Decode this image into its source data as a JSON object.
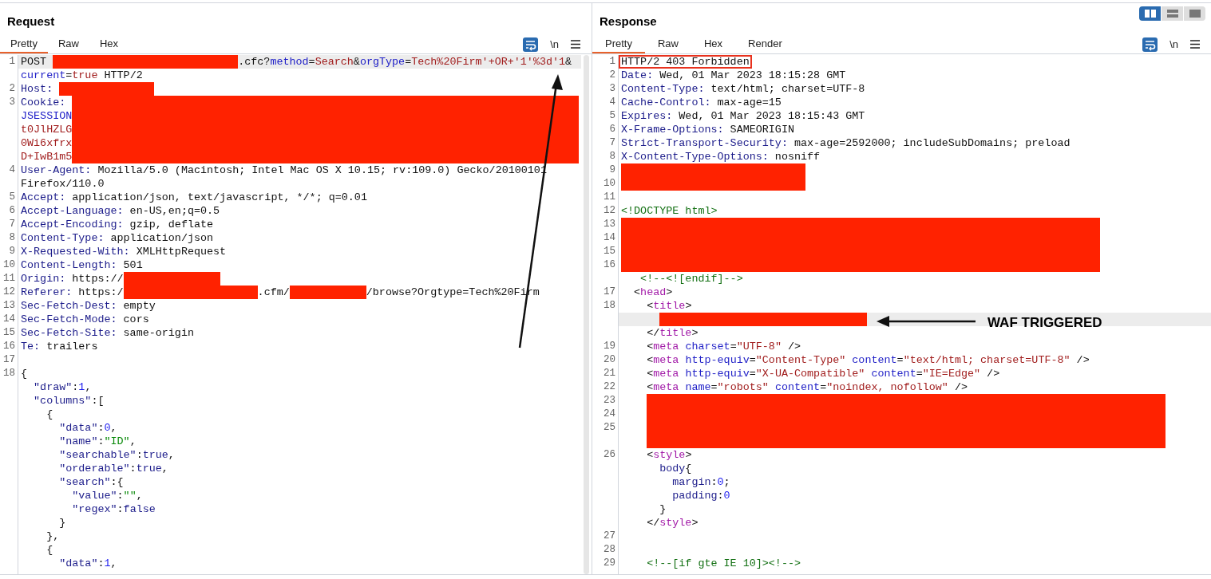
{
  "request": {
    "title": "Request",
    "tabs": [
      {
        "label": "Pretty",
        "selected": true
      },
      {
        "label": "Raw",
        "selected": false
      },
      {
        "label": "Hex",
        "selected": false
      }
    ],
    "newline_toggle": "\\n",
    "rows": [
      {
        "num": "1",
        "highlighted": true,
        "segs": [
          {
            "kind": "text",
            "text": "POST "
          },
          {
            "kind": "redacted"
          },
          {
            "kind": "text",
            "text": ".cfc?"
          },
          {
            "kind": "param",
            "text": "method"
          },
          {
            "kind": "text",
            "text": "="
          },
          {
            "kind": "value",
            "text": "Search"
          },
          {
            "kind": "text",
            "text": "&"
          },
          {
            "kind": "param",
            "text": "orgType"
          },
          {
            "kind": "text",
            "text": "="
          },
          {
            "kind": "value",
            "text": "Tech%20Firm'+OR+'1'%3d'1"
          },
          {
            "kind": "text",
            "text": "&"
          }
        ]
      },
      {
        "segs": [
          {
            "kind": "param",
            "text": "current"
          },
          {
            "kind": "text",
            "text": "="
          },
          {
            "kind": "value",
            "text": "true"
          },
          {
            "kind": "text",
            "text": " HTTP/2"
          }
        ]
      },
      {
        "num": "2",
        "segs": [
          {
            "kind": "key",
            "text": "Host: "
          },
          {
            "kind": "redacted"
          }
        ]
      },
      {
        "num": "3",
        "segs": [
          {
            "kind": "key",
            "text": "Cookie: "
          },
          {
            "kind": "redacted"
          }
        ]
      },
      {
        "segs": [
          {
            "kind": "param",
            "text": "JSESSION"
          },
          {
            "kind": "redacted"
          }
        ]
      },
      {
        "segs": [
          {
            "kind": "value",
            "text": "t0JlHZLG"
          },
          {
            "kind": "redacted"
          }
        ]
      },
      {
        "segs": [
          {
            "kind": "value",
            "text": "0Wi6xfrx"
          },
          {
            "kind": "redacted"
          }
        ]
      },
      {
        "segs": [
          {
            "kind": "value",
            "text": "D+IwB1m5"
          },
          {
            "kind": "redacted"
          }
        ]
      },
      {
        "num": "4",
        "segs": [
          {
            "kind": "key",
            "text": "User-Agent:"
          },
          {
            "kind": "text",
            "text": " Mozilla/5.0 (Macintosh; Intel Mac OS X 10.15; rv:109.0) Gecko/20100101"
          }
        ]
      },
      {
        "segs": [
          {
            "kind": "text",
            "text": "Firefox/110.0"
          }
        ]
      },
      {
        "num": "5",
        "segs": [
          {
            "kind": "key",
            "text": "Accept:"
          },
          {
            "kind": "text",
            "text": " application/json, text/javascript, */*; q=0.01"
          }
        ]
      },
      {
        "num": "6",
        "segs": [
          {
            "kind": "key",
            "text": "Accept-Language:"
          },
          {
            "kind": "text",
            "text": " en-US,en;q=0.5"
          }
        ]
      },
      {
        "num": "7",
        "segs": [
          {
            "kind": "key",
            "text": "Accept-Encoding:"
          },
          {
            "kind": "text",
            "text": " gzip, deflate"
          }
        ]
      },
      {
        "num": "8",
        "segs": [
          {
            "kind": "key",
            "text": "Content-Type:"
          },
          {
            "kind": "text",
            "text": " application/json"
          }
        ]
      },
      {
        "num": "9",
        "segs": [
          {
            "kind": "key",
            "text": "X-Requested-With:"
          },
          {
            "kind": "text",
            "text": " XMLHttpRequest"
          }
        ]
      },
      {
        "num": "10",
        "segs": [
          {
            "kind": "key",
            "text": "Content-Length:"
          },
          {
            "kind": "text",
            "text": " 501"
          }
        ]
      },
      {
        "num": "11",
        "segs": [
          {
            "kind": "key",
            "text": "Origin:"
          },
          {
            "kind": "text",
            "text": " https://"
          },
          {
            "kind": "redacted"
          }
        ]
      },
      {
        "num": "12",
        "segs": [
          {
            "kind": "key",
            "text": "Referer:"
          },
          {
            "kind": "text",
            "text": " https:/"
          },
          {
            "kind": "redacted"
          },
          {
            "kind": "text",
            "text": ".cfm/"
          },
          {
            "kind": "redacted"
          },
          {
            "kind": "text",
            "text": "/browse?Orgtype=Tech%20Firm"
          }
        ]
      },
      {
        "num": "13",
        "segs": [
          {
            "kind": "key",
            "text": "Sec-Fetch-Dest:"
          },
          {
            "kind": "text",
            "text": " empty"
          }
        ]
      },
      {
        "num": "14",
        "segs": [
          {
            "kind": "key",
            "text": "Sec-Fetch-Mode:"
          },
          {
            "kind": "text",
            "text": " cors"
          }
        ]
      },
      {
        "num": "15",
        "segs": [
          {
            "kind": "key",
            "text": "Sec-Fetch-Site:"
          },
          {
            "kind": "text",
            "text": " same-origin"
          }
        ]
      },
      {
        "num": "16",
        "segs": [
          {
            "kind": "key",
            "text": "Te:"
          },
          {
            "kind": "text",
            "text": " trailers"
          }
        ]
      },
      {
        "num": "17",
        "segs": []
      },
      {
        "num": "18",
        "segs": [
          {
            "kind": "text",
            "text": "{"
          }
        ]
      },
      {
        "segs": [
          {
            "kind": "key",
            "text": "  \"draw\""
          },
          {
            "kind": "text",
            "text": ":"
          },
          {
            "kind": "number",
            "text": "1"
          },
          {
            "kind": "text",
            "text": ","
          }
        ]
      },
      {
        "segs": [
          {
            "kind": "key",
            "text": "  \"columns\""
          },
          {
            "kind": "text",
            "text": ":["
          }
        ]
      },
      {
        "segs": [
          {
            "kind": "text",
            "text": "    {"
          }
        ]
      },
      {
        "segs": [
          {
            "kind": "key",
            "text": "      \"data\""
          },
          {
            "kind": "text",
            "text": ":"
          },
          {
            "kind": "number",
            "text": "0"
          },
          {
            "kind": "text",
            "text": ","
          }
        ]
      },
      {
        "segs": [
          {
            "kind": "key",
            "text": "      \"name\""
          },
          {
            "kind": "text",
            "text": ":"
          },
          {
            "kind": "string",
            "text": "\"ID\""
          },
          {
            "kind": "text",
            "text": ","
          }
        ]
      },
      {
        "segs": [
          {
            "kind": "key",
            "text": "      \"searchable\""
          },
          {
            "kind": "text",
            "text": ":"
          },
          {
            "kind": "key",
            "text": "true"
          },
          {
            "kind": "text",
            "text": ","
          }
        ]
      },
      {
        "segs": [
          {
            "kind": "key",
            "text": "      \"orderable\""
          },
          {
            "kind": "text",
            "text": ":"
          },
          {
            "kind": "key",
            "text": "true"
          },
          {
            "kind": "text",
            "text": ","
          }
        ]
      },
      {
        "segs": [
          {
            "kind": "key",
            "text": "      \"search\""
          },
          {
            "kind": "text",
            "text": ":{"
          }
        ]
      },
      {
        "segs": [
          {
            "kind": "key",
            "text": "        \"value\""
          },
          {
            "kind": "text",
            "text": ":"
          },
          {
            "kind": "string",
            "text": "\"\""
          },
          {
            "kind": "text",
            "text": ","
          }
        ]
      },
      {
        "segs": [
          {
            "kind": "key",
            "text": "        \"regex\""
          },
          {
            "kind": "text",
            "text": ":"
          },
          {
            "kind": "key",
            "text": "false"
          }
        ]
      },
      {
        "segs": [
          {
            "kind": "text",
            "text": "      }"
          }
        ]
      },
      {
        "segs": [
          {
            "kind": "text",
            "text": "    },"
          }
        ]
      },
      {
        "segs": [
          {
            "kind": "text",
            "text": "    {"
          }
        ]
      },
      {
        "segs": [
          {
            "kind": "key",
            "text": "      \"data\""
          },
          {
            "kind": "text",
            "text": ":"
          },
          {
            "kind": "number",
            "text": "1"
          },
          {
            "kind": "text",
            "text": ","
          }
        ]
      }
    ]
  },
  "response": {
    "title": "Response",
    "layout_buttons": [
      {
        "kind": "columns",
        "selected": true
      },
      {
        "kind": "rows",
        "selected": false
      },
      {
        "kind": "single",
        "selected": false
      }
    ],
    "tabs": [
      {
        "label": "Pretty",
        "selected": true
      },
      {
        "label": "Raw",
        "selected": false
      },
      {
        "label": "Hex",
        "selected": false
      },
      {
        "label": "Render",
        "selected": false
      }
    ],
    "newline_toggle": "\\n",
    "annotation": {
      "label": "WAF TRIGGERED"
    },
    "rows": [
      {
        "num": "1",
        "segs": [
          {
            "kind": "text",
            "text": "HTTP/2 403 Forbidden",
            "boxed": true
          }
        ]
      },
      {
        "num": "2",
        "segs": [
          {
            "kind": "key",
            "text": "Date:"
          },
          {
            "kind": "text",
            "text": " Wed, 01 Mar 2023 18:15:28 GMT"
          }
        ]
      },
      {
        "num": "3",
        "segs": [
          {
            "kind": "key",
            "text": "Content-Type:"
          },
          {
            "kind": "text",
            "text": " text/html; charset=UTF-8"
          }
        ]
      },
      {
        "num": "4",
        "segs": [
          {
            "kind": "key",
            "text": "Cache-Control:"
          },
          {
            "kind": "text",
            "text": " max-age=15"
          }
        ]
      },
      {
        "num": "5",
        "segs": [
          {
            "kind": "key",
            "text": "Expires:"
          },
          {
            "kind": "text",
            "text": " Wed, 01 Mar 2023 18:15:43 GMT"
          }
        ]
      },
      {
        "num": "6",
        "segs": [
          {
            "kind": "key",
            "text": "X-Frame-Options:"
          },
          {
            "kind": "text",
            "text": " SAMEORIGIN"
          }
        ]
      },
      {
        "num": "7",
        "segs": [
          {
            "kind": "key",
            "text": "Strict-Transport-Security:"
          },
          {
            "kind": "text",
            "text": " max-age=2592000; includeSubDomains; preload"
          }
        ]
      },
      {
        "num": "8",
        "segs": [
          {
            "kind": "key",
            "text": "X-Content-Type-Options:"
          },
          {
            "kind": "text",
            "text": " nosniff"
          }
        ]
      },
      {
        "num": "9",
        "segs": [
          {
            "kind": "redacted"
          }
        ]
      },
      {
        "num": "10",
        "segs": [
          {
            "kind": "redacted"
          }
        ]
      },
      {
        "num": "11",
        "segs": []
      },
      {
        "num": "12",
        "segs": [
          {
            "kind": "comment",
            "text": "<!DOCTYPE html>"
          }
        ]
      },
      {
        "num": "13",
        "segs": [
          {
            "kind": "redacted"
          }
        ]
      },
      {
        "num": "14",
        "segs": [
          {
            "kind": "redacted"
          }
        ]
      },
      {
        "num": "15",
        "segs": [
          {
            "kind": "redacted"
          }
        ]
      },
      {
        "num": "16",
        "segs": [
          {
            "kind": "redacted"
          }
        ]
      },
      {
        "segs": [
          {
            "kind": "comment",
            "text": "   <!--<![endif]-->"
          }
        ]
      },
      {
        "num": "17",
        "segs": [
          {
            "kind": "text",
            "text": "  <"
          },
          {
            "kind": "tag",
            "text": "head"
          },
          {
            "kind": "text",
            "text": ">"
          }
        ]
      },
      {
        "num": "18",
        "segs": [
          {
            "kind": "text",
            "text": "    <"
          },
          {
            "kind": "tag",
            "text": "title"
          },
          {
            "kind": "text",
            "text": ">"
          }
        ]
      },
      {
        "highlighted": true,
        "segs": [
          {
            "kind": "redacted"
          }
        ]
      },
      {
        "segs": [
          {
            "kind": "text",
            "text": "    </"
          },
          {
            "kind": "tag",
            "text": "title"
          },
          {
            "kind": "text",
            "text": ">"
          }
        ]
      },
      {
        "num": "19",
        "segs": [
          {
            "kind": "text",
            "text": "    <"
          },
          {
            "kind": "tag",
            "text": "meta"
          },
          {
            "kind": "attr",
            "text": " charset"
          },
          {
            "kind": "text",
            "text": "="
          },
          {
            "kind": "value",
            "text": "\"UTF-8\""
          },
          {
            "kind": "text",
            "text": " />"
          }
        ]
      },
      {
        "num": "20",
        "segs": [
          {
            "kind": "text",
            "text": "    <"
          },
          {
            "kind": "tag",
            "text": "meta"
          },
          {
            "kind": "attr",
            "text": " http-equiv"
          },
          {
            "kind": "text",
            "text": "="
          },
          {
            "kind": "value",
            "text": "\"Content-Type\""
          },
          {
            "kind": "attr",
            "text": " content"
          },
          {
            "kind": "text",
            "text": "="
          },
          {
            "kind": "value",
            "text": "\"text/html; charset=UTF-8\""
          },
          {
            "kind": "text",
            "text": " />"
          }
        ]
      },
      {
        "num": "21",
        "segs": [
          {
            "kind": "text",
            "text": "    <"
          },
          {
            "kind": "tag",
            "text": "meta"
          },
          {
            "kind": "attr",
            "text": " http-equiv"
          },
          {
            "kind": "text",
            "text": "="
          },
          {
            "kind": "value",
            "text": "\"X-UA-Compatible\""
          },
          {
            "kind": "attr",
            "text": " content"
          },
          {
            "kind": "text",
            "text": "="
          },
          {
            "kind": "value",
            "text": "\"IE=Edge\""
          },
          {
            "kind": "text",
            "text": " />"
          }
        ]
      },
      {
        "num": "22",
        "segs": [
          {
            "kind": "text",
            "text": "    <"
          },
          {
            "kind": "tag",
            "text": "meta"
          },
          {
            "kind": "attr",
            "text": " name"
          },
          {
            "kind": "text",
            "text": "="
          },
          {
            "kind": "value",
            "text": "\"robots\""
          },
          {
            "kind": "attr",
            "text": " content"
          },
          {
            "kind": "text",
            "text": "="
          },
          {
            "kind": "value",
            "text": "\"noindex, nofollow\""
          },
          {
            "kind": "text",
            "text": " />"
          }
        ]
      },
      {
        "num": "23",
        "segs": [
          {
            "kind": "redacted"
          }
        ]
      },
      {
        "num": "24",
        "segs": [
          {
            "kind": "redacted"
          }
        ]
      },
      {
        "num": "25",
        "segs": [
          {
            "kind": "redacted"
          }
        ]
      },
      {
        "segs": [
          {
            "kind": "redacted"
          }
        ]
      },
      {
        "num": "26",
        "segs": [
          {
            "kind": "text",
            "text": "    <"
          },
          {
            "kind": "tag",
            "text": "style"
          },
          {
            "kind": "text",
            "text": ">"
          }
        ]
      },
      {
        "segs": [
          {
            "kind": "key",
            "text": "      body"
          },
          {
            "kind": "text",
            "text": "{"
          }
        ]
      },
      {
        "segs": [
          {
            "kind": "key",
            "text": "        margin"
          },
          {
            "kind": "text",
            "text": ":"
          },
          {
            "kind": "number",
            "text": "0"
          },
          {
            "kind": "text",
            "text": ";"
          }
        ]
      },
      {
        "segs": [
          {
            "kind": "key",
            "text": "        padding"
          },
          {
            "kind": "text",
            "text": ":"
          },
          {
            "kind": "number",
            "text": "0"
          }
        ]
      },
      {
        "segs": [
          {
            "kind": "text",
            "text": "      }"
          }
        ]
      },
      {
        "segs": [
          {
            "kind": "text",
            "text": "    </"
          },
          {
            "kind": "tag",
            "text": "style"
          },
          {
            "kind": "text",
            "text": ">"
          }
        ]
      },
      {
        "num": "27",
        "segs": []
      },
      {
        "num": "28",
        "segs": []
      },
      {
        "num": "29",
        "segs": [
          {
            "kind": "comment",
            "text": "    <!--[if gte IE 10]><!-->"
          }
        ]
      }
    ]
  }
}
